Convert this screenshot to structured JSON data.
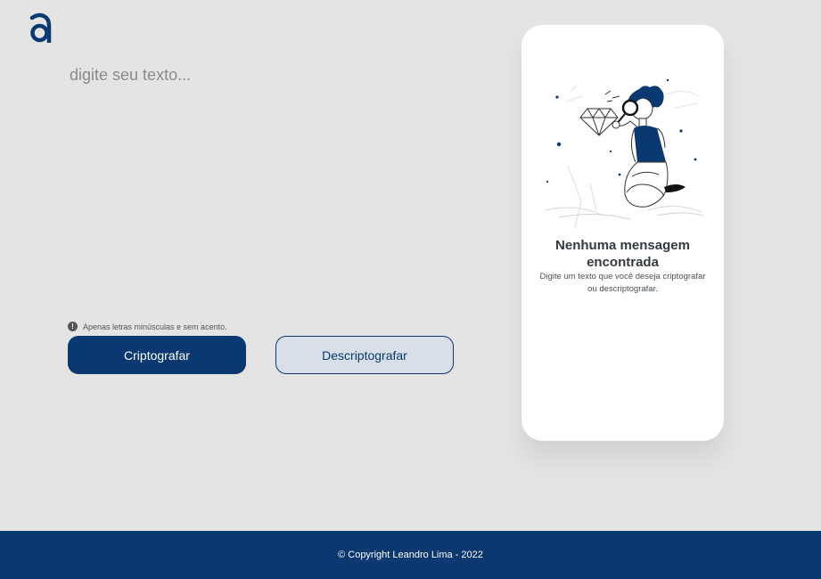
{
  "brand": {
    "logo_icon": "alura-a-logo-icon",
    "color_primary": "#0a3871",
    "color_secondary_bg": "#d8dfe8",
    "color_page_bg": "#e4e4e4"
  },
  "editor": {
    "placeholder": "digite seu texto...",
    "value": ""
  },
  "hint": {
    "icon": "exclamation-circle-icon",
    "text": "Apenas letras minúsculas e sem acento."
  },
  "buttons": {
    "encrypt_label": "Criptografar",
    "decrypt_label": "Descriptografar"
  },
  "output_card": {
    "illustration": "person-with-magnifying-glass-illustration",
    "title": "Nenhuma mensagem encontrada",
    "text": "Digite um texto que você deseja criptografar ou descriptografar."
  },
  "footer": {
    "text": "© Copyright Leandro Lima - 2022"
  }
}
